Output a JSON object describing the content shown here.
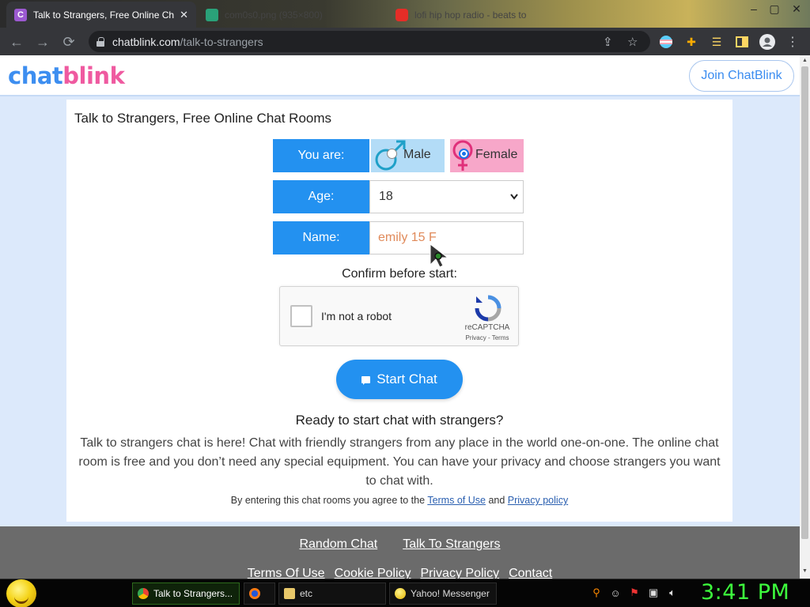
{
  "browser": {
    "tabs": [
      {
        "title": "Talk to Strangers, Free Online Ch",
        "favicon": "C",
        "active": true
      },
      {
        "title": "com0s0.png (935×800)",
        "favicon": "",
        "active": false
      },
      {
        "title": "lofi hip hop radio - beats to",
        "favicon": "",
        "active": false
      }
    ],
    "url_host": "chatblink.com",
    "url_path": "/talk-to-strangers",
    "window_controls": [
      "–",
      "▢",
      "✕"
    ]
  },
  "site": {
    "logo_part1": "chat",
    "logo_part2": "blink",
    "join_label": "Join ChatBlink"
  },
  "form": {
    "title": "Talk to Strangers, Free Online Chat Rooms",
    "gender_label": "You are:",
    "male_label": "Male",
    "female_label": "Female",
    "selected_gender": "female",
    "age_label": "Age:",
    "age_value": "18",
    "name_label": "Name:",
    "name_value": "emily 15 F",
    "confirm_text": "Confirm before start:",
    "captcha_label": "I'm not a robot",
    "captcha_brand": "reCAPTCHA",
    "captcha_links": "Privacy - Terms",
    "start_label": "Start Chat"
  },
  "info": {
    "ready_title": "Ready to start chat with strangers?",
    "description": "Talk to strangers chat is here! Chat with friendly strangers from any place in the world one-on-one. The online chat room is free and you don’t need any special equipment. You can have your privacy and choose strangers you want to chat with.",
    "terms_prefix": "By entering this chat rooms you agree to the",
    "terms_link": "Terms of Use",
    "terms_and": "and",
    "privacy_link": "Privacy policy"
  },
  "footer": {
    "links_row1": [
      "Random Chat",
      "Talk To Strangers"
    ],
    "links_row2": [
      "Terms Of Use",
      "Cookie Policy",
      "Privacy Policy",
      "Contact"
    ]
  },
  "taskbar": {
    "tasks": [
      {
        "label": "Talk to Strangers...",
        "icon": "chrome-icon"
      },
      {
        "label": "",
        "icon": "firefox-icon"
      },
      {
        "label": "etc",
        "icon": "folder-icon"
      },
      {
        "label": "Yahoo! Messenger",
        "icon": "yahoo-icon"
      }
    ],
    "clock": "3:41 PM"
  },
  "colors": {
    "accent_blue": "#2391f0",
    "male_bg": "#b3dcf7",
    "female_bg": "#f7a7c9",
    "page_bg": "#dce9fb",
    "clock_green": "#3dfc3d"
  }
}
